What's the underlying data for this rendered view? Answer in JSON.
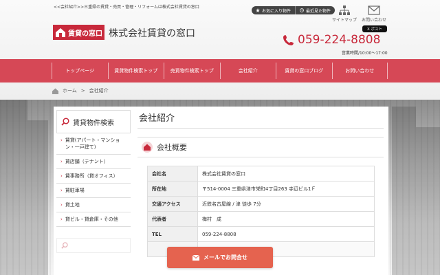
{
  "header": {
    "tagline": "<<会社紹介>>三重県の賃貸・売買・管理・リフォームは株式会社賃貸の窓口",
    "favorites_label": "お気に入り物件",
    "recent_label": "最近見た物件",
    "sitemap_label": "サイトマップ",
    "contact_label": "お問い合わせ",
    "x_post_label": "X ポスト",
    "logo_text": "賃貸の窓口",
    "company_name": "株式会社賃貸の窓口",
    "phone": "059-224-8808",
    "hours": "営業時間/10:00〜17:00"
  },
  "nav": {
    "items": [
      {
        "label": "トップページ"
      },
      {
        "label": "賃貸物件検索トップ"
      },
      {
        "label": "売買物件検索トップ"
      },
      {
        "label": "会社紹介"
      },
      {
        "label": "賃貸の窓口ブログ"
      },
      {
        "label": "お問い合わせ"
      }
    ]
  },
  "breadcrumb": {
    "home": "ホーム",
    "separator": ">",
    "current": "会社紹介"
  },
  "sidebar": {
    "title": "賃貸物件検索",
    "items": [
      {
        "label": "賃貸(アパート・マンション・一戸建て)"
      },
      {
        "label": "賃店舗（テナント）"
      },
      {
        "label": "賃事務所（貸オフィス）"
      },
      {
        "label": "賃駐車場"
      },
      {
        "label": "貸土地"
      },
      {
        "label": "貸ビル・貸倉庫・その他"
      }
    ],
    "arrow": "›"
  },
  "main": {
    "page_title": "会社紹介",
    "section_title": "会社概要",
    "rows": [
      {
        "key": "会社名",
        "value": "株式会社賃貸の窓口"
      },
      {
        "key": "所在地",
        "value": "〒514-0004 三重県津市栄町4丁目263 寺辺ビル1Ｆ"
      },
      {
        "key": "交通アクセス",
        "value": "近鉄名古屋線 / 津 徒歩 7分"
      },
      {
        "key": "代表者",
        "value": "梅村　成"
      },
      {
        "key": "TEL",
        "value": "059-224-8808"
      }
    ]
  },
  "cta": {
    "label": "メールでお問合せ"
  },
  "colors": {
    "brand_red": "#c8293b",
    "nav_red": "#d64856",
    "cta_orange": "#e5634f"
  }
}
